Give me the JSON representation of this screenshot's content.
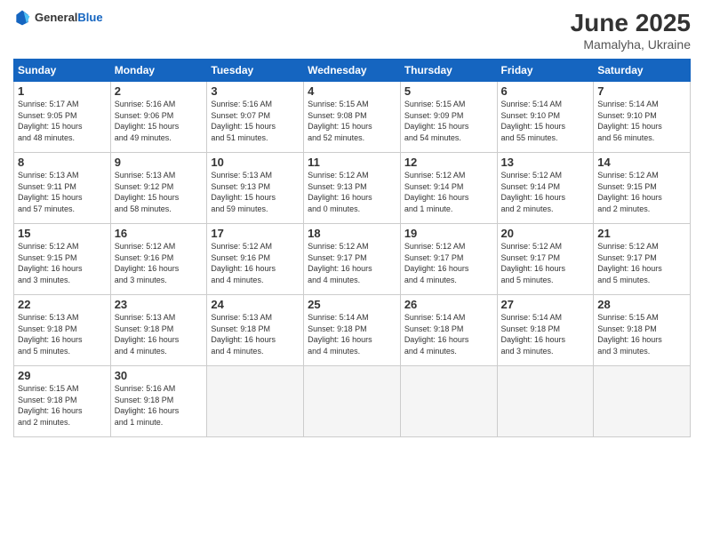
{
  "logo": {
    "general": "General",
    "blue": "Blue"
  },
  "header": {
    "month": "June 2025",
    "location": "Mamalyha, Ukraine"
  },
  "weekdays": [
    "Sunday",
    "Monday",
    "Tuesday",
    "Wednesday",
    "Thursday",
    "Friday",
    "Saturday"
  ],
  "weeks": [
    [
      {
        "day": "1",
        "info": "Sunrise: 5:17 AM\nSunset: 9:05 PM\nDaylight: 15 hours\nand 48 minutes."
      },
      {
        "day": "2",
        "info": "Sunrise: 5:16 AM\nSunset: 9:06 PM\nDaylight: 15 hours\nand 49 minutes."
      },
      {
        "day": "3",
        "info": "Sunrise: 5:16 AM\nSunset: 9:07 PM\nDaylight: 15 hours\nand 51 minutes."
      },
      {
        "day": "4",
        "info": "Sunrise: 5:15 AM\nSunset: 9:08 PM\nDaylight: 15 hours\nand 52 minutes."
      },
      {
        "day": "5",
        "info": "Sunrise: 5:15 AM\nSunset: 9:09 PM\nDaylight: 15 hours\nand 54 minutes."
      },
      {
        "day": "6",
        "info": "Sunrise: 5:14 AM\nSunset: 9:10 PM\nDaylight: 15 hours\nand 55 minutes."
      },
      {
        "day": "7",
        "info": "Sunrise: 5:14 AM\nSunset: 9:10 PM\nDaylight: 15 hours\nand 56 minutes."
      }
    ],
    [
      {
        "day": "8",
        "info": "Sunrise: 5:13 AM\nSunset: 9:11 PM\nDaylight: 15 hours\nand 57 minutes."
      },
      {
        "day": "9",
        "info": "Sunrise: 5:13 AM\nSunset: 9:12 PM\nDaylight: 15 hours\nand 58 minutes."
      },
      {
        "day": "10",
        "info": "Sunrise: 5:13 AM\nSunset: 9:13 PM\nDaylight: 15 hours\nand 59 minutes."
      },
      {
        "day": "11",
        "info": "Sunrise: 5:12 AM\nSunset: 9:13 PM\nDaylight: 16 hours\nand 0 minutes."
      },
      {
        "day": "12",
        "info": "Sunrise: 5:12 AM\nSunset: 9:14 PM\nDaylight: 16 hours\nand 1 minute."
      },
      {
        "day": "13",
        "info": "Sunrise: 5:12 AM\nSunset: 9:14 PM\nDaylight: 16 hours\nand 2 minutes."
      },
      {
        "day": "14",
        "info": "Sunrise: 5:12 AM\nSunset: 9:15 PM\nDaylight: 16 hours\nand 2 minutes."
      }
    ],
    [
      {
        "day": "15",
        "info": "Sunrise: 5:12 AM\nSunset: 9:15 PM\nDaylight: 16 hours\nand 3 minutes."
      },
      {
        "day": "16",
        "info": "Sunrise: 5:12 AM\nSunset: 9:16 PM\nDaylight: 16 hours\nand 3 minutes."
      },
      {
        "day": "17",
        "info": "Sunrise: 5:12 AM\nSunset: 9:16 PM\nDaylight: 16 hours\nand 4 minutes."
      },
      {
        "day": "18",
        "info": "Sunrise: 5:12 AM\nSunset: 9:17 PM\nDaylight: 16 hours\nand 4 minutes."
      },
      {
        "day": "19",
        "info": "Sunrise: 5:12 AM\nSunset: 9:17 PM\nDaylight: 16 hours\nand 4 minutes."
      },
      {
        "day": "20",
        "info": "Sunrise: 5:12 AM\nSunset: 9:17 PM\nDaylight: 16 hours\nand 5 minutes."
      },
      {
        "day": "21",
        "info": "Sunrise: 5:12 AM\nSunset: 9:17 PM\nDaylight: 16 hours\nand 5 minutes."
      }
    ],
    [
      {
        "day": "22",
        "info": "Sunrise: 5:13 AM\nSunset: 9:18 PM\nDaylight: 16 hours\nand 5 minutes."
      },
      {
        "day": "23",
        "info": "Sunrise: 5:13 AM\nSunset: 9:18 PM\nDaylight: 16 hours\nand 4 minutes."
      },
      {
        "day": "24",
        "info": "Sunrise: 5:13 AM\nSunset: 9:18 PM\nDaylight: 16 hours\nand 4 minutes."
      },
      {
        "day": "25",
        "info": "Sunrise: 5:14 AM\nSunset: 9:18 PM\nDaylight: 16 hours\nand 4 minutes."
      },
      {
        "day": "26",
        "info": "Sunrise: 5:14 AM\nSunset: 9:18 PM\nDaylight: 16 hours\nand 4 minutes."
      },
      {
        "day": "27",
        "info": "Sunrise: 5:14 AM\nSunset: 9:18 PM\nDaylight: 16 hours\nand 3 minutes."
      },
      {
        "day": "28",
        "info": "Sunrise: 5:15 AM\nSunset: 9:18 PM\nDaylight: 16 hours\nand 3 minutes."
      }
    ],
    [
      {
        "day": "29",
        "info": "Sunrise: 5:15 AM\nSunset: 9:18 PM\nDaylight: 16 hours\nand 2 minutes."
      },
      {
        "day": "30",
        "info": "Sunrise: 5:16 AM\nSunset: 9:18 PM\nDaylight: 16 hours\nand 1 minute."
      },
      {
        "day": "",
        "info": ""
      },
      {
        "day": "",
        "info": ""
      },
      {
        "day": "",
        "info": ""
      },
      {
        "day": "",
        "info": ""
      },
      {
        "day": "",
        "info": ""
      }
    ]
  ]
}
